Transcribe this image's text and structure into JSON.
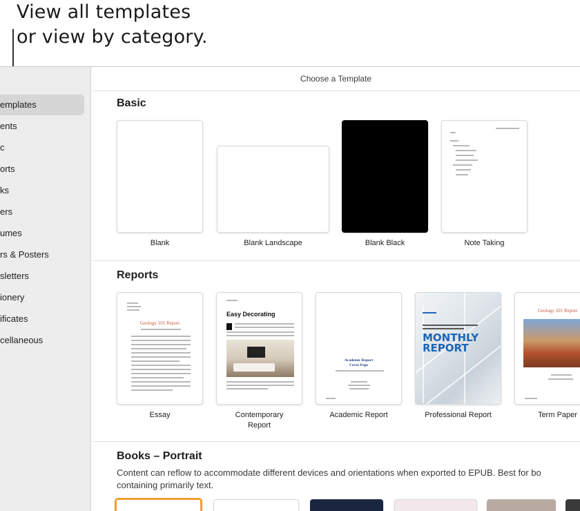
{
  "callout": {
    "line1": "View all templates",
    "line2": "or view by category."
  },
  "window": {
    "title": "Choose a Template"
  },
  "sidebar": {
    "items": [
      {
        "label": "emplates",
        "active": true
      },
      {
        "label": "ents"
      },
      {
        "label": "c"
      },
      {
        "label": "orts"
      },
      {
        "label": "ks"
      },
      {
        "label": "ers"
      },
      {
        "label": "umes"
      },
      {
        "label": "rs & Posters"
      },
      {
        "label": "sletters"
      },
      {
        "label": "ionery"
      },
      {
        "label": "ificates"
      },
      {
        "label": "cellaneous"
      }
    ]
  },
  "sections": {
    "basic": {
      "title": "Basic",
      "templates": [
        {
          "label": "Blank"
        },
        {
          "label": "Blank Landscape"
        },
        {
          "label": "Blank Black"
        },
        {
          "label": "Note Taking"
        }
      ]
    },
    "reports": {
      "title": "Reports",
      "templates": [
        {
          "label": "Essay",
          "preview_title": "Geology 101 Report"
        },
        {
          "label_line1": "Contemporary",
          "label_line2": "Report",
          "preview_title": "Easy Decorating"
        },
        {
          "label": "Academic Report",
          "preview_title": "Academic Report",
          "preview_subtitle": "Cover Page"
        },
        {
          "label": "Professional Report",
          "preview_title_line1": "MONTHLY",
          "preview_title_line2": "REPORT"
        },
        {
          "label": "Term Paper",
          "preview_title": "Geology 101 Report"
        }
      ]
    },
    "books": {
      "title": "Books – Portrait",
      "desc_line1": "Content can reflow to accommodate different devices and orientations when exported to EPUB. Best for bo",
      "desc_line2": "containing primarily text."
    }
  },
  "colors": {
    "sidebar_bg": "#ededed",
    "accent_orange": "#f0a030",
    "report_blue": "#1b65b6"
  }
}
